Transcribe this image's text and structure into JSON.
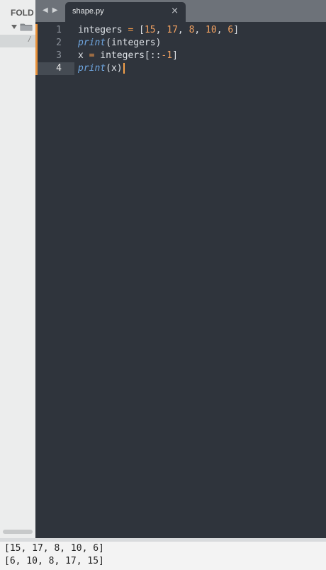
{
  "sidebar": {
    "header": "FOLD",
    "file_glyph": "/"
  },
  "tabbar": {
    "back_arrow": "◀",
    "forward_arrow": "▶",
    "tab": {
      "label": "shape.py",
      "close": "×"
    }
  },
  "editor": {
    "line_numbers": [
      "1",
      "2",
      "3",
      "4"
    ],
    "lines": [
      {
        "tokens": [
          {
            "text": "integers ",
            "kind": "pn"
          },
          {
            "text": "=",
            "kind": "op"
          },
          {
            "text": " [",
            "kind": "pn"
          },
          {
            "text": "15",
            "kind": "num"
          },
          {
            "text": ", ",
            "kind": "pn"
          },
          {
            "text": "17",
            "kind": "num"
          },
          {
            "text": ", ",
            "kind": "pn"
          },
          {
            "text": "8",
            "kind": "num"
          },
          {
            "text": ", ",
            "kind": "pn"
          },
          {
            "text": "10",
            "kind": "num"
          },
          {
            "text": ", ",
            "kind": "pn"
          },
          {
            "text": "6",
            "kind": "num"
          },
          {
            "text": "]",
            "kind": "pn"
          }
        ]
      },
      {
        "tokens": [
          {
            "text": "print",
            "kind": "fn"
          },
          {
            "text": "(integers)",
            "kind": "pn"
          }
        ]
      },
      {
        "tokens": [
          {
            "text": "x ",
            "kind": "pn"
          },
          {
            "text": "=",
            "kind": "op"
          },
          {
            "text": " integers[::",
            "kind": "pn"
          },
          {
            "text": "-1",
            "kind": "num"
          },
          {
            "text": "]",
            "kind": "pn"
          }
        ]
      },
      {
        "tokens": [
          {
            "text": "print",
            "kind": "fn"
          },
          {
            "text": "(x)",
            "kind": "pn"
          }
        ]
      }
    ]
  },
  "console": {
    "lines": [
      "[15, 17, 8, 10, 6]",
      "[6, 10, 8, 17, 15]"
    ]
  },
  "colors": {
    "accent": "#e8913a",
    "editor_bg": "#2f343c",
    "tabbar_bg": "#6d7279"
  }
}
